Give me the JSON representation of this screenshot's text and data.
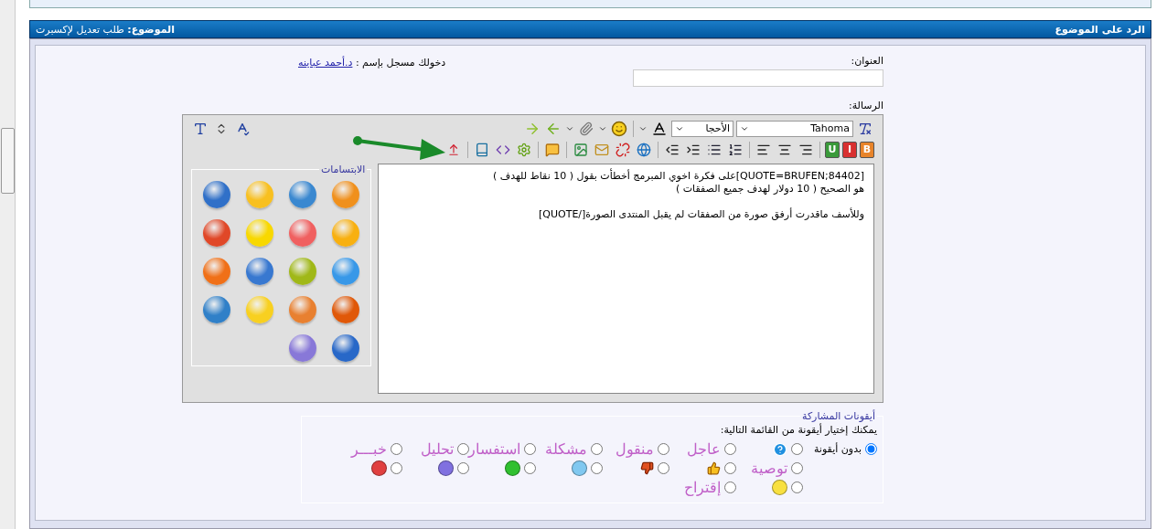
{
  "header": {
    "title": "الرد على الموضوع",
    "subject": "**الموضوع:** طلب تعديل لإكسبرت"
  },
  "form": {
    "title_label": "العنوان:",
    "login_text": "دخولك مسجل بإسم :",
    "login_user": "د.أحمد عباينه",
    "message_label": "الرسالة:"
  },
  "toolbar": {
    "font": "Tahoma",
    "size": "الأحجا",
    "format_buttons": [
      {
        "label": "B",
        "color": "#e8842a"
      },
      {
        "label": "I",
        "color": "#d83030"
      },
      {
        "label": "U",
        "color": "#3a9a3a"
      }
    ]
  },
  "message": "[QUOTE=BRUFEN;84402]على فكرة اخوي المبرمج أخطأت بقول ( 10 نقاط للهدف )\nهو الصحيح ( 10 دولار لهدف جميع الصفقات )\n\nوللأسف ماقدرت أرفق صورة من الصفقات لم يقبل المنتدى الصورة[/QUOTE]",
  "smilies": {
    "title": "الابتسامات",
    "items": [
      {
        "color": "#f0901c"
      },
      {
        "color": "#3a88d0"
      },
      {
        "color": "#f8c020"
      },
      {
        "color": "#3070c8"
      },
      {
        "color": "#f8b010"
      },
      {
        "color": "#f06060"
      },
      {
        "color": "#f8d800"
      },
      {
        "color": "#e04828"
      },
      {
        "color": "#3898e8"
      },
      {
        "color": "#a0b818"
      },
      {
        "color": "#3878d0"
      },
      {
        "color": "#f07018"
      },
      {
        "color": "#e05808"
      },
      {
        "color": "#e88030"
      },
      {
        "color": "#f8d020"
      },
      {
        "color": "#3080c8"
      },
      {
        "color": "#2868c8"
      },
      {
        "color": "#8878d8"
      }
    ]
  },
  "post_icons": {
    "title": "أيقونات المشاركة",
    "hint": "يمكنك إختيار أيقونة من القائمة التالية:",
    "items": [
      {
        "kind": "none",
        "label": "بدون أيقونة",
        "selected": true
      },
      {
        "kind": "question",
        "selected": false
      },
      {
        "kind": "text",
        "label": "عاجل",
        "selected": false
      },
      {
        "kind": "text",
        "label": "منقول",
        "selected": false
      },
      {
        "kind": "text",
        "label": "مشكلة",
        "selected": false
      },
      {
        "kind": "text",
        "label": "استفسار",
        "selected": false
      },
      {
        "kind": "text",
        "label": "تحليل",
        "selected": false
      },
      {
        "kind": "text",
        "label": "خبـــر",
        "selected": false
      },
      {
        "kind": "text",
        "label": "توصية",
        "selected": false
      },
      {
        "kind": "thumbs-up",
        "selected": false
      },
      {
        "kind": "thumbs-down",
        "selected": false
      },
      {
        "kind": "face",
        "color": "#80c8f0",
        "selected": false
      },
      {
        "kind": "face",
        "color": "#30c030",
        "selected": false
      },
      {
        "kind": "face",
        "color": "#8070e0",
        "selected": false
      },
      {
        "kind": "face",
        "color": "#e04040",
        "selected": false
      },
      {
        "kind": "face",
        "color": "#f8e040",
        "selected": false
      },
      {
        "kind": "text",
        "label": "إقتراح",
        "selected": false
      }
    ]
  }
}
